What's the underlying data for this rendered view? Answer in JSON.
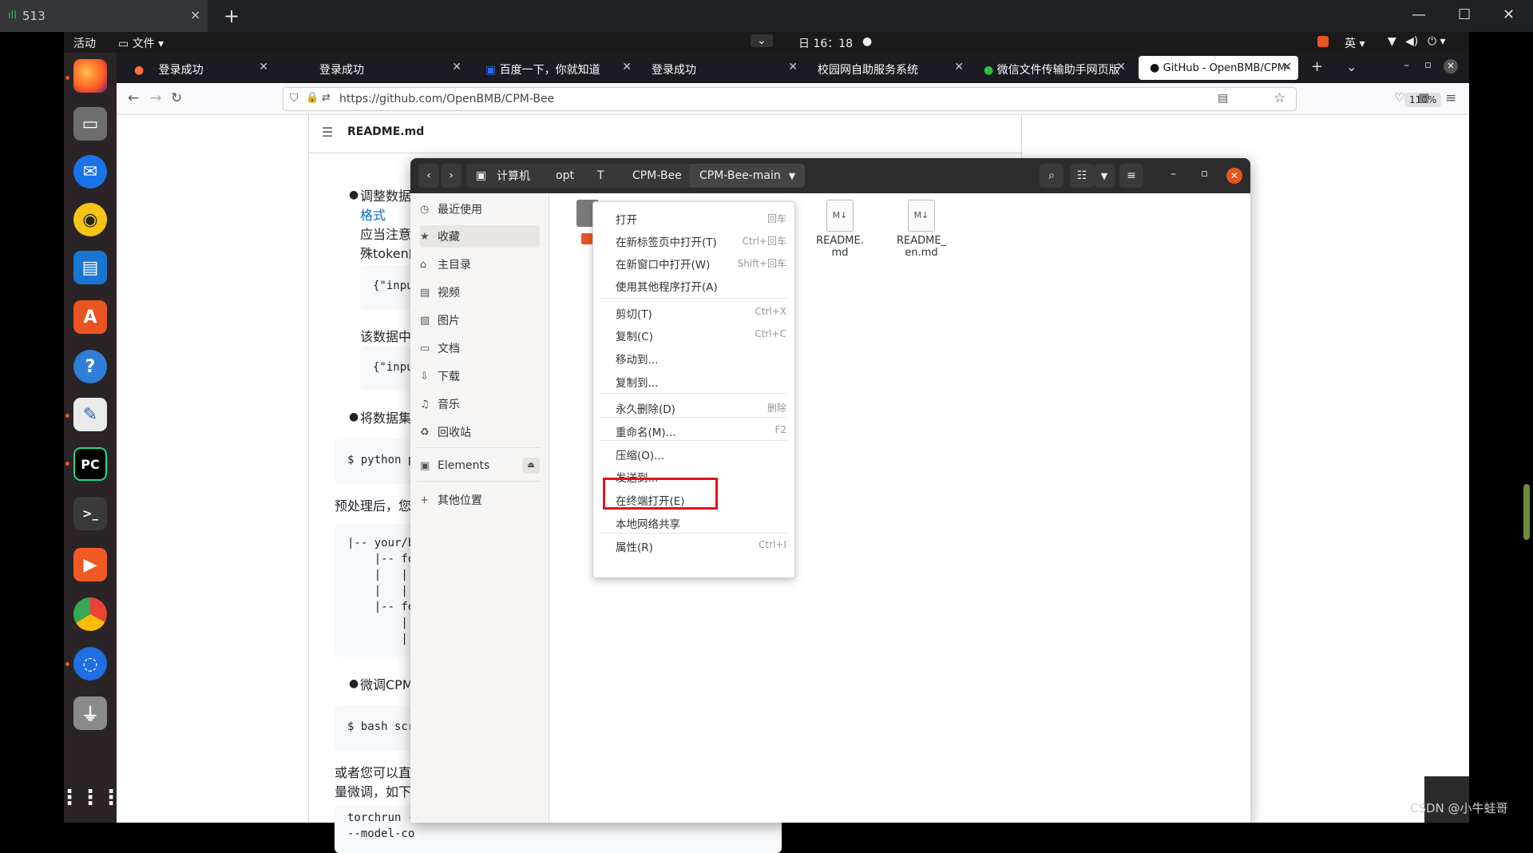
{
  "host": {
    "tab_signal": "ıll",
    "tab_label": "513",
    "tab_close": "×",
    "new_tab": "+",
    "min": "—",
    "max": "☐",
    "close": "✕"
  },
  "panel": {
    "activities": "活动",
    "files_menu": "文件",
    "clock": "日 16：18",
    "input_method": "英"
  },
  "browser": {
    "tabs": [
      {
        "label": "登录成功"
      },
      {
        "label": "登录成功"
      },
      {
        "label": "百度一下，你就知道"
      },
      {
        "label": "登录成功"
      },
      {
        "label": "校园网自助服务系统"
      },
      {
        "label": "微信文件传输助手网页版"
      },
      {
        "label": "GitHub - OpenBMB/CPM-"
      }
    ],
    "url": "https://github.com/OpenBMB/CPM-Bee",
    "zoom": "110%"
  },
  "github": {
    "readme_title": "README.md",
    "lines": {
      "l1": "调整数据",
      "l2": "格式",
      "l3": "应当注意",
      "l4": "殊token的",
      "code1": "{\"inpu",
      "l5": "该数据中",
      "code2": "{\"inpu",
      "l6": "将数据集",
      "code3": "$ python p",
      "l7": "预处理后，您",
      "tree1": "|-- your/b",
      "tree2": "    |-- fo",
      "tree3": "    |   |",
      "tree4": "    |   |",
      "tree5": "    |-- fo",
      "tree6": "        |",
      "tree7": "        |",
      "l8": "微调CPM",
      "code4": "$ bash scr",
      "l9": "或者您可以直",
      "l10": "量微调，如下",
      "code5a": "torchrun -",
      "code5b": "--model-co"
    }
  },
  "nautilus": {
    "crumbs": [
      "计算机",
      "opt",
      "T",
      "CPM-Bee",
      "CPM-Bee-main"
    ],
    "sidebar": [
      {
        "icon": "◷",
        "label": "最近使用"
      },
      {
        "icon": "★",
        "label": "收藏"
      },
      {
        "icon": "⌂",
        "label": "主目录"
      },
      {
        "icon": "▤",
        "label": "视频"
      },
      {
        "icon": "▧",
        "label": "图片"
      },
      {
        "icon": "▭",
        "label": "文档"
      },
      {
        "icon": "⇩",
        "label": "下载"
      },
      {
        "icon": "♫",
        "label": "音乐"
      },
      {
        "icon": "♻",
        "label": "回收站"
      },
      {
        "icon": "▣",
        "label": "Elements"
      },
      {
        "icon": "+",
        "label": "其他位置"
      }
    ],
    "files": [
      {
        "name": "README.\nmd"
      },
      {
        "name": "README_\nen.md"
      }
    ],
    "file_badge": "M↓"
  },
  "context_menu": {
    "items": [
      {
        "label": "打开",
        "shortcut": "回车"
      },
      {
        "label": "在新标签页中打开(T)",
        "shortcut": "Ctrl+回车"
      },
      {
        "label": "在新窗口中打开(W)",
        "shortcut": "Shift+回车"
      },
      {
        "label": "使用其他程序打开(A)",
        "shortcut": ""
      },
      {
        "label": "剪切(T)",
        "shortcut": "Ctrl+X"
      },
      {
        "label": "复制(C)",
        "shortcut": "Ctrl+C"
      },
      {
        "label": "移动到...",
        "shortcut": ""
      },
      {
        "label": "复制到...",
        "shortcut": ""
      },
      {
        "label": "永久删除(D)",
        "shortcut": "删除"
      },
      {
        "label": "重命名(M)...",
        "shortcut": "F2"
      },
      {
        "label": "压缩(O)...",
        "shortcut": ""
      },
      {
        "label": "发送到...",
        "shortcut": ""
      },
      {
        "label": "在终端打开(E)",
        "shortcut": ""
      },
      {
        "label": "本地网络共享",
        "shortcut": ""
      },
      {
        "label": "属性(R)",
        "shortcut": "Ctrl+I"
      }
    ]
  },
  "watermark": "CSDN @小牛蛙哥",
  "colors": {
    "highlight_box": "#e5121c",
    "ubuntu_orange": "#e95420",
    "github_link": "#0969da"
  }
}
